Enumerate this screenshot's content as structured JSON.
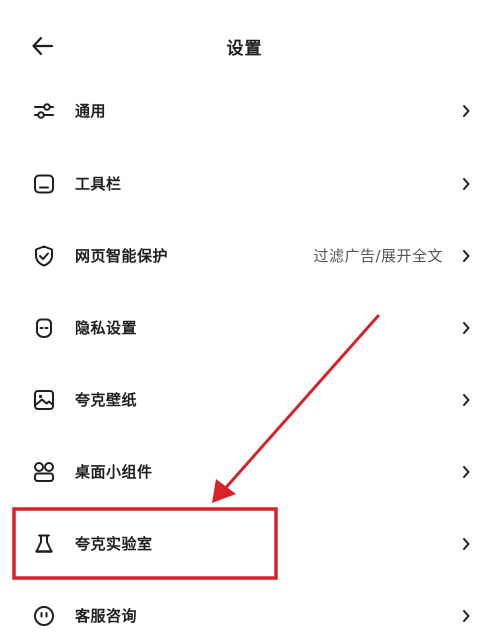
{
  "header": {
    "title": "设置"
  },
  "menu": [
    {
      "icon": "sliders-icon",
      "label": "通用",
      "value": ""
    },
    {
      "icon": "toolbar-icon",
      "label": "工具栏",
      "value": ""
    },
    {
      "icon": "shield-check-icon",
      "label": "网页智能保护",
      "value": "过滤广告/展开全文"
    },
    {
      "icon": "privacy-face-icon",
      "label": "隐私设置",
      "value": ""
    },
    {
      "icon": "wallpaper-icon",
      "label": "夸克壁纸",
      "value": ""
    },
    {
      "icon": "widgets-icon",
      "label": "桌面小组件",
      "value": ""
    },
    {
      "icon": "flask-icon",
      "label": "夸克实验室",
      "value": ""
    },
    {
      "icon": "customer-service-icon",
      "label": "客服咨询",
      "value": ""
    }
  ],
  "annotation": {
    "color": "#d8222a"
  }
}
